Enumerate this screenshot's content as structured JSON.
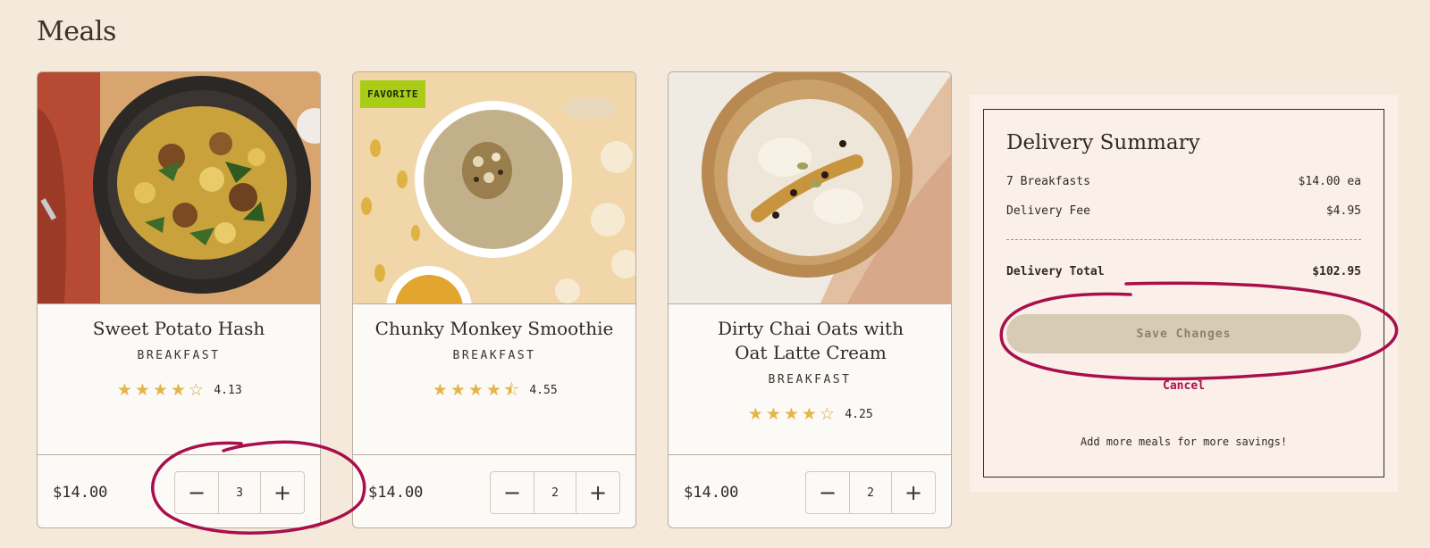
{
  "page": {
    "title": "Meals"
  },
  "meals": [
    {
      "name": "Sweet Potato Hash",
      "category": "BREAKFAST",
      "rating": 4.13,
      "rating_label": "4.13",
      "stars": [
        "full",
        "full",
        "full",
        "full",
        "empty"
      ],
      "price": "$14.00",
      "quantity": "3",
      "badge": ""
    },
    {
      "name": "Chunky Monkey Smoothie",
      "category": "BREAKFAST",
      "rating": 4.55,
      "rating_label": "4.55",
      "stars": [
        "full",
        "full",
        "full",
        "full",
        "half"
      ],
      "price": "$14.00",
      "quantity": "2",
      "badge": "FAVORITE"
    },
    {
      "name": "Dirty Chai Oats with Oat Latte Cream",
      "category": "BREAKFAST",
      "rating": 4.25,
      "rating_label": "4.25",
      "stars": [
        "full",
        "full",
        "full",
        "full",
        "empty"
      ],
      "price": "$14.00",
      "quantity": "2",
      "badge": ""
    }
  ],
  "stepper": {
    "minus": "−",
    "plus": "+"
  },
  "summary": {
    "title": "Delivery Summary",
    "lines": [
      {
        "label": "7 Breakfasts",
        "value": "$14.00 ea"
      },
      {
        "label": "Delivery Fee",
        "value": "$4.95"
      }
    ],
    "total_label": "Delivery Total",
    "total_value": "$102.95",
    "save_label": "Save Changes",
    "cancel_label": "Cancel",
    "note": "Add more meals for more savings!"
  },
  "icons": {
    "star_full": "★",
    "star_half": "⯪",
    "star_empty": "☆"
  },
  "colors": {
    "background": "#f4e9da",
    "accent": "#a80f4c",
    "badge": "#a9cc16",
    "star": "#e6b54a",
    "save_disabled": "#d8cbb5"
  }
}
